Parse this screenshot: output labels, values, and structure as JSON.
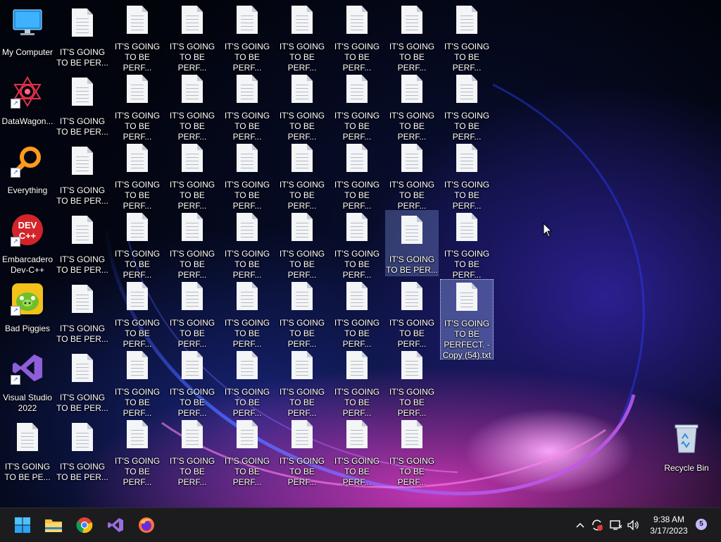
{
  "desktop": {
    "left_icons": [
      {
        "label": "My Computer"
      },
      {
        "label": "DataWagon..."
      },
      {
        "label": "Everything"
      },
      {
        "label": "Embarcadero\nDev-C++"
      },
      {
        "label": "Bad Piggies"
      },
      {
        "label": "Visual Studio\n2022"
      },
      {
        "label": "IT'S GOING\nTO BE PE..."
      }
    ],
    "file_rows": [
      [
        "IT'S GOING\nTO BE PER...",
        "IT'S GOING\nTO BE PERF...",
        "IT'S GOING\nTO BE PERF...",
        "IT'S GOING\nTO BE PERF...",
        "IT'S GOING\nTO BE PERF...",
        "IT'S GOING\nTO BE PERF...",
        "IT'S GOING\nTO BE PERF...",
        "IT'S GOING\nTO BE PERF..."
      ],
      [
        "IT'S GOING\nTO BE PER...",
        "IT'S GOING\nTO BE PERF...",
        "IT'S GOING\nTO BE PERF...",
        "IT'S GOING\nTO BE PERF...",
        "IT'S GOING\nTO BE PERF...",
        "IT'S GOING\nTO BE PERF...",
        "IT'S GOING\nTO BE PERF...",
        "IT'S GOING\nTO BE PERF..."
      ],
      [
        "IT'S GOING\nTO BE PER...",
        "IT'S GOING\nTO BE PERF...",
        "IT'S GOING\nTO BE PERF...",
        "IT'S GOING\nTO BE PERF...",
        "IT'S GOING\nTO BE PERF...",
        "IT'S GOING\nTO BE PERF...",
        "IT'S GOING\nTO BE PERF...",
        "IT'S GOING\nTO BE PERF..."
      ],
      [
        "IT'S GOING\nTO BE PER...",
        "IT'S GOING\nTO BE PERF...",
        "IT'S GOING\nTO BE PERF...",
        "IT'S GOING\nTO BE PERF...",
        "IT'S GOING\nTO BE PERF...",
        "IT'S GOING\nTO BE PERF...",
        "IT'S GOING\nTO BE PER...",
        "IT'S GOING\nTO BE PERF..."
      ],
      [
        "IT'S GOING\nTO BE PER...",
        "IT'S GOING\nTO BE PERF...",
        "IT'S GOING\nTO BE PERF...",
        "IT'S GOING\nTO BE PERF...",
        "IT'S GOING\nTO BE PERF...",
        "IT'S GOING\nTO BE PERF...",
        "IT'S GOING\nTO BE PERF...",
        "IT'S GOING\nTO BE\nPERFECT. -\nCopy (54).txt"
      ],
      [
        "IT'S GOING\nTO BE PER...",
        "IT'S GOING\nTO BE PERF...",
        "IT'S GOING\nTO BE PERF...",
        "IT'S GOING\nTO BE PERF...",
        "IT'S GOING\nTO BE PERF...",
        "IT'S GOING\nTO BE PERF...",
        "IT'S GOING\nTO BE PERF..."
      ],
      [
        "IT'S GOING\nTO BE PER...",
        "IT'S GOING\nTO BE PERF...",
        "IT'S GOING\nTO BE PERF...",
        "IT'S GOING\nTO BE PERF...",
        "IT'S GOING\nTO BE PERF...",
        "IT'S GOING\nTO BE PERF...",
        "IT'S GOING\nTO BE PERF..."
      ]
    ],
    "recycle_bin": {
      "label": "Recycle Bin"
    }
  },
  "taskbar": {
    "apps": [
      {
        "name": "Start",
        "icon": "windows-start-icon"
      },
      {
        "name": "File Explorer",
        "icon": "folder-icon"
      },
      {
        "name": "Google Chrome",
        "icon": "chrome-icon"
      },
      {
        "name": "Visual Studio",
        "icon": "visual-studio-icon"
      },
      {
        "name": "Firefox",
        "icon": "firefox-icon"
      }
    ],
    "tray": {
      "chevron": "^",
      "time": "9:38 AM",
      "date": "3/17/2023",
      "notification_count": "5"
    }
  },
  "colors": {
    "taskbar_bg": "#1c1c1e",
    "selection": "#8296dc",
    "notification_badge": "#c7b9ff"
  }
}
